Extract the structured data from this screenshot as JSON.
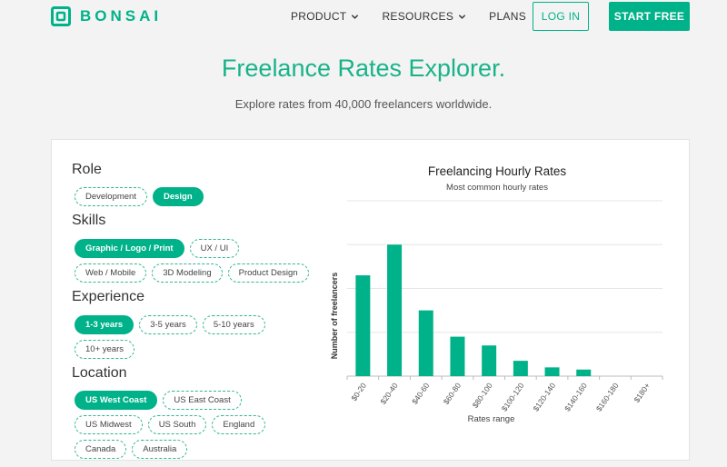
{
  "brand": {
    "name": "BONSAI",
    "color": "#00b289"
  },
  "nav": {
    "items": [
      {
        "label": "PRODUCT",
        "has_dropdown": true
      },
      {
        "label": "RESOURCES",
        "has_dropdown": true
      },
      {
        "label": "PLANS",
        "has_dropdown": false
      }
    ],
    "login_label": "LOG IN",
    "start_label": "START FREE"
  },
  "hero": {
    "title": "Freelance Rates Explorer.",
    "subtitle": "Explore rates from 40,000 freelancers worldwide."
  },
  "filters": {
    "role": {
      "heading": "Role",
      "options": [
        {
          "label": "Development",
          "active": false
        },
        {
          "label": "Design",
          "active": true
        }
      ]
    },
    "skills": {
      "heading": "Skills",
      "options": [
        {
          "label": "Graphic / Logo / Print",
          "active": true
        },
        {
          "label": "UX / UI",
          "active": false
        },
        {
          "label": "Web / Mobile",
          "active": false
        },
        {
          "label": "3D Modeling",
          "active": false
        },
        {
          "label": "Product Design",
          "active": false
        }
      ]
    },
    "experience": {
      "heading": "Experience",
      "options": [
        {
          "label": "1-3 years",
          "active": true
        },
        {
          "label": "3-5 years",
          "active": false
        },
        {
          "label": "5-10 years",
          "active": false
        },
        {
          "label": "10+ years",
          "active": false
        }
      ]
    },
    "location": {
      "heading": "Location",
      "options": [
        {
          "label": "US West Coast",
          "active": true
        },
        {
          "label": "US East Coast",
          "active": false
        },
        {
          "label": "US Midwest",
          "active": false
        },
        {
          "label": "US South",
          "active": false
        },
        {
          "label": "England",
          "active": false
        },
        {
          "label": "Canada",
          "active": false
        },
        {
          "label": "Australia",
          "active": false
        }
      ]
    }
  },
  "chart_data": {
    "type": "bar",
    "title": "Freelancing Hourly Rates",
    "subtitle": "Most common hourly rates",
    "xlabel": "Rates range",
    "ylabel": "Number of freelancers",
    "categories": [
      "$0-20",
      "$20-40",
      "$40-60",
      "$60-80",
      "$80-100",
      "$100-120",
      "$120-140",
      "$140-160",
      "$160-180",
      "$180+"
    ],
    "values": [
      23,
      30,
      15,
      9,
      7,
      3.5,
      2,
      1.5,
      0,
      0
    ],
    "ylim": [
      0,
      40
    ],
    "grid": true,
    "bar_color": "#00b289"
  }
}
